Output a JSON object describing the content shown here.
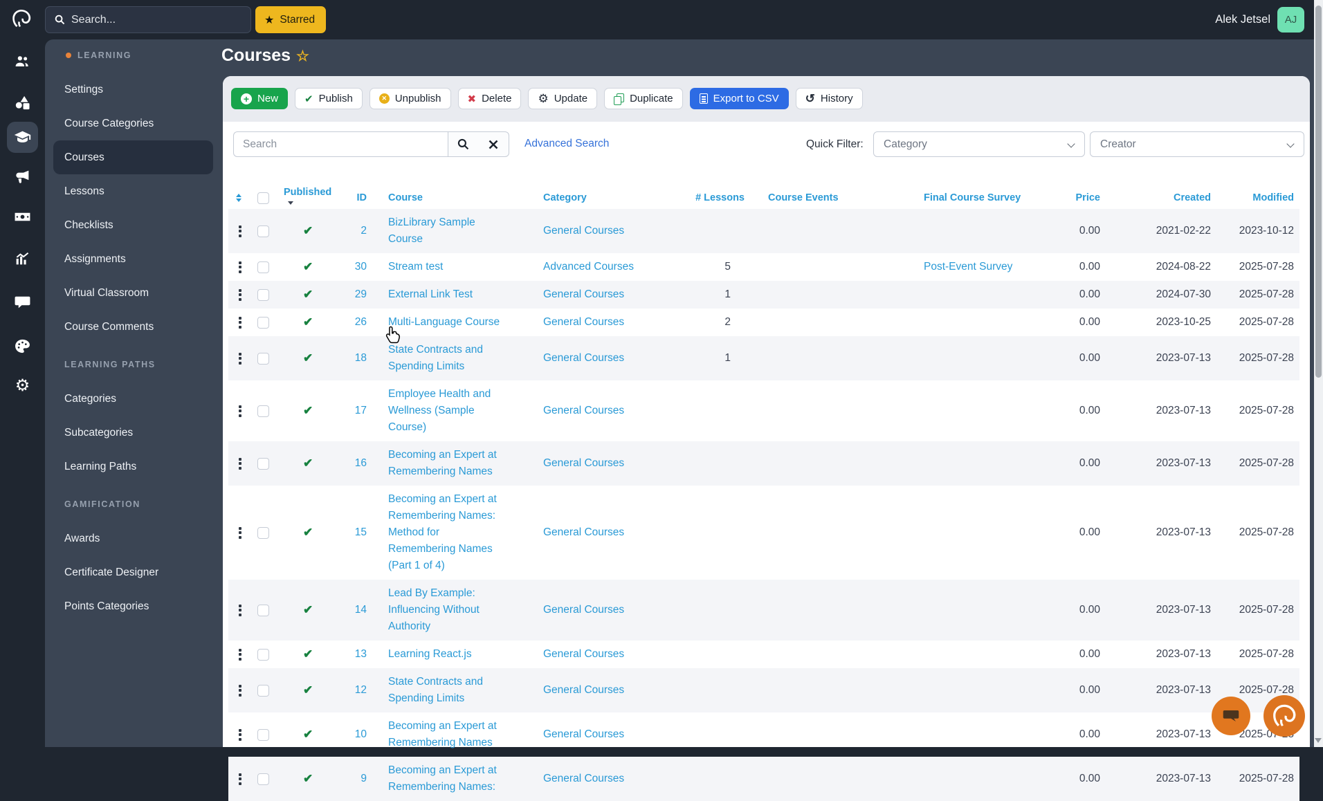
{
  "topbar": {
    "search_placeholder": "Search...",
    "starred_label": "Starred",
    "user_name": "Alek Jetsel",
    "user_initials": "AJ"
  },
  "rail": {
    "items": [
      "users",
      "shapes",
      "graduation-cap",
      "megaphone",
      "money",
      "analytics",
      "chat",
      "palette",
      "gear"
    ],
    "active": "graduation-cap"
  },
  "sidebar": {
    "sections": [
      {
        "label": "LEARNING",
        "dot": true,
        "active": "Courses",
        "items": [
          "Settings",
          "Course Categories",
          "Courses",
          "Lessons",
          "Checklists",
          "Assignments",
          "Virtual Classroom",
          "Course Comments"
        ]
      },
      {
        "label": "LEARNING PATHS",
        "dot": false,
        "items": [
          "Categories",
          "Subcategories",
          "Learning Paths"
        ]
      },
      {
        "label": "GAMIFICATION",
        "dot": false,
        "items": [
          "Awards",
          "Certificate Designer",
          "Points Categories"
        ]
      }
    ]
  },
  "page": {
    "title": "Courses"
  },
  "toolbar": {
    "buttons": [
      {
        "label": "New",
        "icon": "plus-circle",
        "variant": "green"
      },
      {
        "label": "Publish",
        "icon": "check",
        "variant": "default"
      },
      {
        "label": "Unpublish",
        "icon": "circle-x",
        "variant": "default"
      },
      {
        "label": "Delete",
        "icon": "x",
        "variant": "default"
      },
      {
        "label": "Update",
        "icon": "gear",
        "variant": "default"
      },
      {
        "label": "Duplicate",
        "icon": "copy",
        "variant": "default"
      },
      {
        "label": "Export to CSV",
        "icon": "file",
        "variant": "blue"
      },
      {
        "label": "History",
        "icon": "history",
        "variant": "default"
      }
    ]
  },
  "filters": {
    "search_placeholder": "Search",
    "advanced_search_label": "Advanced Search",
    "quick_filter_label": "Quick Filter:",
    "category_placeholder": "Category",
    "creator_placeholder": "Creator"
  },
  "table": {
    "columns": [
      "Published",
      "ID",
      "Course",
      "Category",
      "# Lessons",
      "Course Events",
      "Final Course Survey",
      "Price",
      "Created",
      "Modified"
    ],
    "rows": [
      {
        "published": true,
        "id": "2",
        "course": "BizLibrary Sample Course",
        "category": "General Courses",
        "lessons": "",
        "events": "",
        "survey": "",
        "price": "0.00",
        "created": "2021-02-22",
        "modified": "2023-10-12"
      },
      {
        "published": true,
        "id": "30",
        "course": "Stream test",
        "category": "Advanced Courses",
        "lessons": "5",
        "events": "",
        "survey": "Post-Event Survey",
        "price": "0.00",
        "created": "2024-08-22",
        "modified": "2025-07-28"
      },
      {
        "published": true,
        "id": "29",
        "course": "External Link Test",
        "category": "General Courses",
        "lessons": "1",
        "events": "",
        "survey": "",
        "price": "0.00",
        "created": "2024-07-30",
        "modified": "2025-07-28"
      },
      {
        "published": true,
        "id": "26",
        "course": "Multi-Language Course",
        "category": "General Courses",
        "lessons": "2",
        "events": "",
        "survey": "",
        "price": "0.00",
        "created": "2023-10-25",
        "modified": "2025-07-28"
      },
      {
        "published": true,
        "id": "18",
        "course": "State Contracts and Spending Limits",
        "category": "General Courses",
        "lessons": "1",
        "events": "",
        "survey": "",
        "price": "0.00",
        "created": "2023-07-13",
        "modified": "2025-07-28"
      },
      {
        "published": true,
        "id": "17",
        "course": "Employee Health and Wellness (Sample Course)",
        "category": "General Courses",
        "lessons": "",
        "events": "",
        "survey": "",
        "price": "0.00",
        "created": "2023-07-13",
        "modified": "2025-07-28"
      },
      {
        "published": true,
        "id": "16",
        "course": "Becoming an Expert at Remembering Names",
        "category": "General Courses",
        "lessons": "",
        "events": "",
        "survey": "",
        "price": "0.00",
        "created": "2023-07-13",
        "modified": "2025-07-28"
      },
      {
        "published": true,
        "id": "15",
        "course": "Becoming an Expert at Remembering Names: Method for Remembering Names (Part 1 of 4)",
        "category": "General Courses",
        "lessons": "",
        "events": "",
        "survey": "",
        "price": "0.00",
        "created": "2023-07-13",
        "modified": "2025-07-28"
      },
      {
        "published": true,
        "id": "14",
        "course": "Lead By Example: Influencing Without Authority",
        "category": "General Courses",
        "lessons": "",
        "events": "",
        "survey": "",
        "price": "0.00",
        "created": "2023-07-13",
        "modified": "2025-07-28"
      },
      {
        "published": true,
        "id": "13",
        "course": "Learning React.js",
        "category": "General Courses",
        "lessons": "",
        "events": "",
        "survey": "",
        "price": "0.00",
        "created": "2023-07-13",
        "modified": "2025-07-28"
      },
      {
        "published": true,
        "id": "12",
        "course": "State Contracts and Spending Limits",
        "category": "General Courses",
        "lessons": "",
        "events": "",
        "survey": "",
        "price": "0.00",
        "created": "2023-07-13",
        "modified": "2025-07-28"
      },
      {
        "published": true,
        "id": "10",
        "course": "Becoming an Expert at Remembering Names",
        "category": "General Courses",
        "lessons": "",
        "events": "",
        "survey": "",
        "price": "0.00",
        "created": "2023-07-13",
        "modified": "2025-07-28"
      },
      {
        "published": true,
        "id": "9",
        "course": "Becoming an Expert at Remembering Names:",
        "category": "General Courses",
        "lessons": "",
        "events": "",
        "survey": "",
        "price": "0.00",
        "created": "2023-07-13",
        "modified": "2025-07-28"
      }
    ]
  },
  "colors": {
    "topbar_bg": "#1f2630",
    "sidebar_bg": "#3b4554",
    "accent_orange": "#e8833a",
    "starred_yellow": "#eeb71e",
    "avatar_teal": "#6fe0b2",
    "button_green": "#18a44c",
    "export_blue": "#2d6be4",
    "link_blue": "#2a9ad6",
    "advanced_link_blue": "#3672d9",
    "published_green": "#17813f",
    "delete_red": "#d23b4a",
    "row_stripe": "#f4f5f8",
    "widget_orange": "#dd7420"
  }
}
